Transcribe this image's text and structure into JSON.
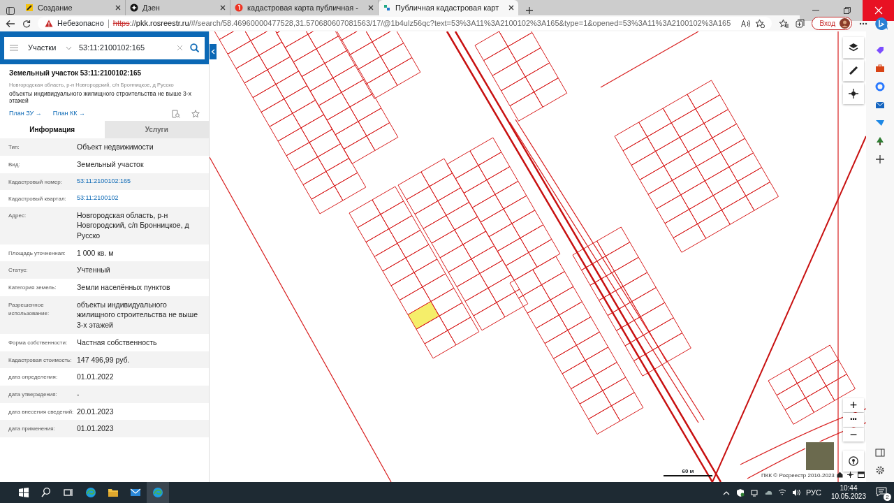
{
  "browser": {
    "tabs": [
      {
        "label": "Создание",
        "selected": false
      },
      {
        "label": "Дзен",
        "selected": false
      },
      {
        "label": "кадастровая карта публичная -",
        "selected": false
      },
      {
        "label": "Публичная кадастровая карт",
        "selected": true
      }
    ],
    "security": "Небезопасно",
    "url_scheme": "https",
    "url_separator": "://",
    "url_host": "pkk.rosreestr.ru",
    "url_rest": "/#/search/58.46960000477528,31.570680607081563/17/@1b4ulz56qc?text=53%3A11%3A2100102%3A165&type=1&opened=53%3A11%3A2100102%3A165",
    "login": "Вход"
  },
  "search": {
    "type": "Участки",
    "value": "53:11:2100102:165"
  },
  "object": {
    "title": "Земельный участок 53:11:2100102:165",
    "address": "Новгородская область, р-н Новгородский, с/п Бронницкое, д Русско",
    "purpose": "объекты индивидуального жилищного строительства не выше 3-х этажей",
    "links": [
      "План ЗУ →",
      "План КК →"
    ]
  },
  "panel_tabs": [
    {
      "label": "Информация",
      "selected": true
    },
    {
      "label": "Услуги",
      "selected": false
    }
  ],
  "info": [
    {
      "label": "Тип:",
      "value": "Объект недвижимости",
      "kind": "text"
    },
    {
      "label": "Вид:",
      "value": "Земельный участок",
      "kind": "text"
    },
    {
      "label": "Кадастровый номер:",
      "value": "53:11:2100102:165",
      "kind": "link"
    },
    {
      "label": "Кадастровый квартал:",
      "value": "53:11:2100102",
      "kind": "link"
    },
    {
      "label": "Адрес:",
      "value": "Новгородская область, р-н Новгородский, с/п Бронницкое, д Русско",
      "kind": "text"
    },
    {
      "label": "Площадь уточненная:",
      "value": "1 000 кв. м",
      "kind": "text"
    },
    {
      "label": "Статус:",
      "value": "Учтенный",
      "kind": "text"
    },
    {
      "label": "Категория земель:",
      "value": "Земли населённых пунктов",
      "kind": "text"
    },
    {
      "label": "Разрешенное использование:",
      "value": "объекты индивидуального жилищного строительства не выше 3-х этажей",
      "kind": "text"
    },
    {
      "label": "Форма собственности:",
      "value": "Частная собственность",
      "kind": "text"
    },
    {
      "label": "Кадастровая стоимость:",
      "value": "147 496,99 руб.",
      "kind": "text"
    },
    {
      "label": "дата определения:",
      "value": "01.01.2022",
      "kind": "text"
    },
    {
      "label": "дата утверждения:",
      "value": "-",
      "kind": "text"
    },
    {
      "label": "дата внесения сведений:",
      "value": "20.01.2023",
      "kind": "text"
    },
    {
      "label": "дата применения:",
      "value": "01.01.2023",
      "kind": "text"
    }
  ],
  "map": {
    "zoom_buttons": [
      "+",
      "•••",
      "−"
    ],
    "scale": "60 м",
    "attribution": "ПКК © Росреестр 2010-2023"
  },
  "taskbar": {
    "language": "РУС",
    "time": "10:44",
    "date": "10.05.2023",
    "notifications": "2"
  }
}
